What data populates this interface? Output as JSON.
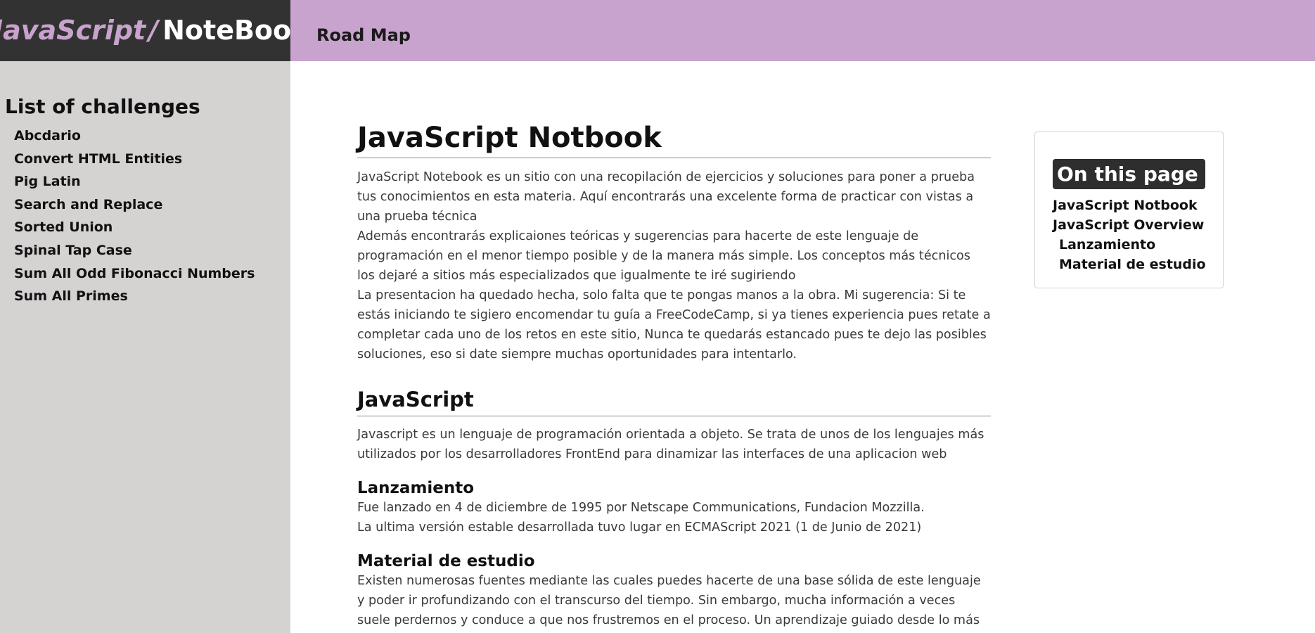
{
  "header": {
    "brand_js": "JavaScript",
    "brand_slash": "/",
    "brand_notebook": "NoteBook",
    "nav_link": "Road Map"
  },
  "sidebar": {
    "title": "List of challenges",
    "items": [
      {
        "label": "Abcdario"
      },
      {
        "label": "Convert HTML Entities"
      },
      {
        "label": "Pig Latin"
      },
      {
        "label": "Search and Replace"
      },
      {
        "label": "Sorted Union"
      },
      {
        "label": "Spinal Tap Case"
      },
      {
        "label": "Sum All Odd Fibonacci Numbers"
      },
      {
        "label": "Sum All Primes"
      }
    ]
  },
  "main": {
    "title": "JavaScript Notbook",
    "intro": [
      "JavaScript Notebook es un sitio con una recopilación de ejercicios y soluciones para poner a prueba tus conocimientos en esta materia. Aquí encontrarás una excelente forma de practicar con vistas a una prueba técnica",
      "Además encontrarás explicaiones teóricas y sugerencias para hacerte de este lenguaje de programación en el menor tiempo posible y de la manera más simple. Los conceptos más técnicos los dejaré a sitios más especializados que igualmente te iré sugiriendo",
      "La presentacion ha quedado hecha, solo falta que te pongas manos a la obra. Mi sugerencia: Si te estás iniciando te sigiero encomendar tu guía a FreeCodeCamp, si ya tienes experiencia pues retate a completar cada uno de los retos en este sitio, Nunca te quedarás estancado pues te dejo las posibles soluciones, eso si date siempre muchas oportunidades para intentarlo."
    ],
    "js_heading": "JavaScript",
    "js_para": "Javascript es un lenguaje de programación orientada a objeto. Se trata de unos de los lenguajes más utilizados por los desarrolladores FrontEnd para dinamizar las interfaces de una aplicacion web",
    "launch_heading": "Lanzamiento",
    "launch_lines": [
      "Fue lanzado en 4 de diciembre de 1995 por Netscape Communications, Fundacion Mozzilla.",
      "La ultima versión estable desarrollada tuvo lugar en ECMAScript 2021 (1 de Junio de 2021)"
    ],
    "material_heading": "Material de estudio",
    "material_para": "Existen numerosas fuentes mediante las cuales puedes hacerte de una base sólida de este lenguaje y poder ir profundizando con el transcurso del tiempo. Sin embargo, mucha información a veces suele perdernos y conduce a que nos frustremos en el proceso. Un aprendizaje guiado desde lo más simple hasta lo más"
  },
  "toc": {
    "title": "On this page",
    "items": [
      {
        "label": "JavaScript Notbook"
      },
      {
        "label": "JavaScript Overview"
      },
      {
        "label": "Lanzamiento"
      },
      {
        "label": "Material de estudio"
      }
    ]
  },
  "colors": {
    "accent": "#c8a3cd",
    "dark": "#323232",
    "sidebar_bg": "#d5d2d2"
  }
}
